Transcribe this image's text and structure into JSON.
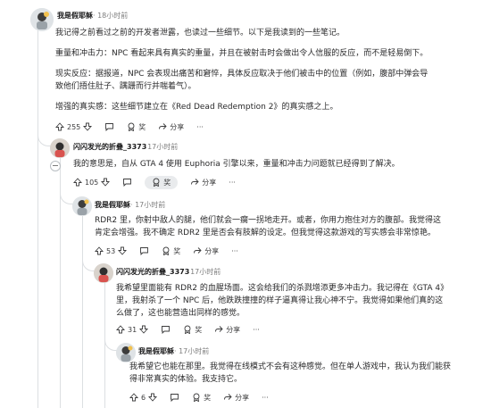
{
  "colors": {
    "line": "#dcdfe2",
    "meta": "#7c7c7c",
    "text": "#2a2a2b",
    "accent_pill": "#e9ebed"
  },
  "comments": [
    {
      "user": "我是假耶稣",
      "time": "18小时前",
      "paragraphs": [
        "我记得之前看过之前的开发者泄露，也读过一些细节。以下是我读到的一些笔记。",
        "重量和冲击力：NPC 看起来具有真实的重量，并且在被射击时会做出令人信服的反应，而不是轻易倒下。",
        "现实反应：据报道，NPC 会表现出痛苦和窘悴，具体反应取决于他们被击中的位置（例如，腹部中弹会导致他们捂住肚子、蹒跚而行并喘着气）。",
        "增强的真实感：这些细节建立在《Red Dead Redemption 2》的真实感之上。"
      ],
      "votes": "255",
      "reply_icon": "comment-icon",
      "award": "奖",
      "share": "分享",
      "more": "···"
    },
    {
      "user": "闪闪发光的折叠_3373",
      "time": "17小时前",
      "paragraphs": [
        "我的意思是，自从 GTA 4 使用 Euphoria 引擎以来，重量和冲击力问题就已经得到了解决。"
      ],
      "votes": "105",
      "award": "奖",
      "share": "分享",
      "more": "···"
    },
    {
      "user": "我是假耶稣",
      "time": "17小时前",
      "paragraphs": [
        "RDR2 里，你射中敌人的腿，他们就会一瘸一拐地走开。或者，你用力抱住对方的腹部。我觉得这肯定会增强。我不确定 RDR2 里是否会有肢解的设定。但我觉得这款游戏的写实感会非常惊艳。"
      ],
      "votes": "53",
      "award": "奖",
      "share": "分享",
      "more": "···"
    },
    {
      "user": "闪闪发光的折叠_3373",
      "time": "17小时前",
      "paragraphs": [
        "我希望里面能有 RDR2 的血腥场面。这会给我们的杀戮增添更多冲击力。我记得在《GTA 4》里，我射杀了一个 NPC 后，他跌跌撞撞的样子逼真得让我心神不宁。我觉得如果他们真的这么做了，这也能营造出同样的感觉。"
      ],
      "votes": "31",
      "award": "奖",
      "share": "分享",
      "more": "···"
    },
    {
      "user": "我是假耶稣",
      "time": "17小时前",
      "paragraphs": [
        "我希望它也能在那里。我觉得在线模式不会有这种感觉。但在单人游戏中，我认为我们能获得非常真实的体验。我支持它。"
      ],
      "votes": "6",
      "award": "奖",
      "share": "分享",
      "more": "···"
    }
  ]
}
